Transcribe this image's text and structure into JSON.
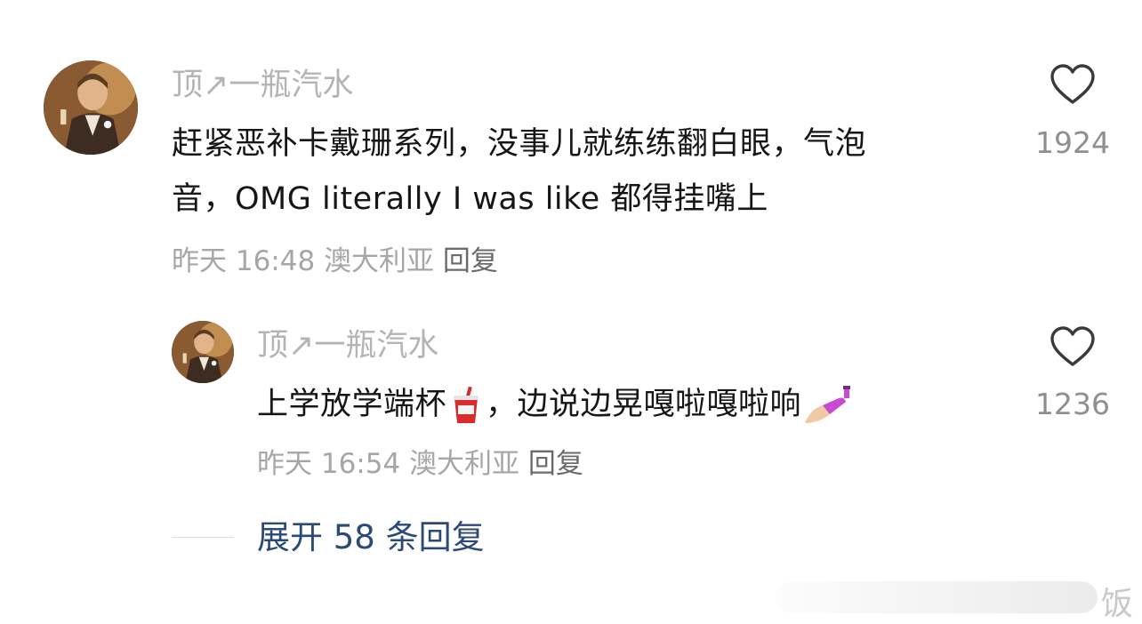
{
  "comments": [
    {
      "username": "顶↗一瓶汽水",
      "text_line1": "赶紧恶补卡戴珊系列，没事儿就练练翻白眼，气泡",
      "text_line2": "音，OMG literally I was like 都得挂嘴上",
      "time": "昨天 16:48",
      "location": "澳大利亚",
      "reply_label": "回复",
      "likes": "1924",
      "like_icon": "heart-outline-icon"
    },
    {
      "username": "顶↗一瓶汽水",
      "text_before": "上学放学端杯",
      "text_emoji1": "cup-with-straw-emoji",
      "text_middle": "，边说边晃嘎啦嘎啦响",
      "text_emoji2": "nail-polish-emoji",
      "time": "昨天 16:54",
      "location": "澳大利亚",
      "reply_label": "回复",
      "likes": "1236",
      "like_icon": "heart-outline-icon"
    }
  ],
  "expand_replies": "展开 58 条回复",
  "watermark": "饭",
  "colors": {
    "username": "#b4b4b4",
    "text": "#161616",
    "meta": "#a6a6a6",
    "link": "#2b4a78"
  }
}
